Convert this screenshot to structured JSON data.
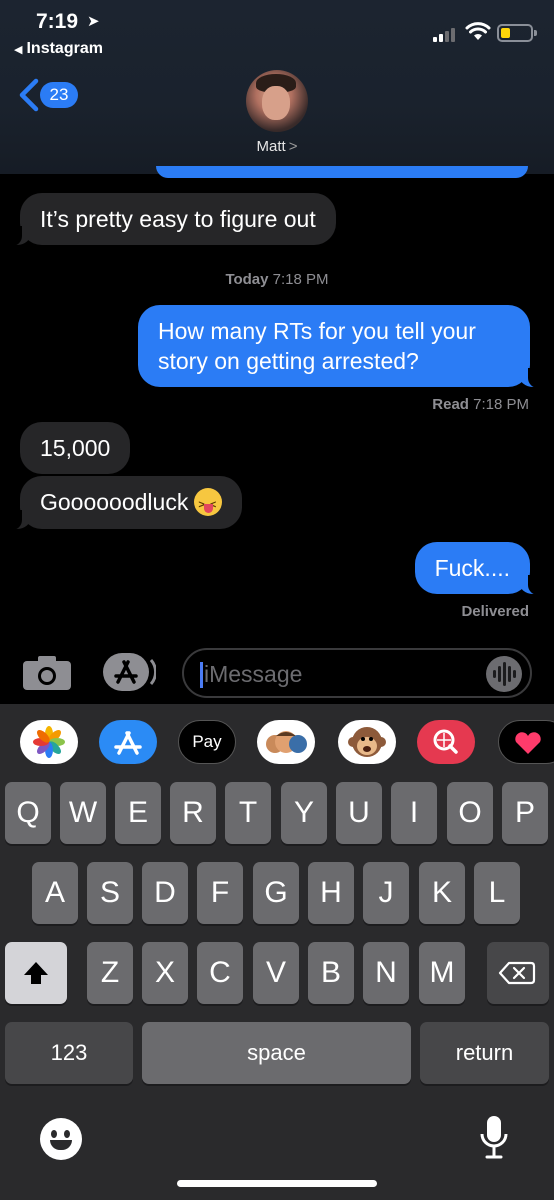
{
  "status_bar": {
    "time": "7:19",
    "back_app": "Instagram"
  },
  "header": {
    "back_count": "23",
    "contact_name": "Matt",
    "contact_chevron": ">"
  },
  "messages": [
    {
      "type": "received",
      "text": "It’s pretty easy to figure out"
    },
    {
      "type": "timestamp",
      "day": "Today",
      "time": "7:18 PM"
    },
    {
      "type": "sent",
      "text": "How many RTs for you tell your story on getting arrested?"
    },
    {
      "type": "receipt",
      "label": "Read",
      "time": "7:18 PM"
    },
    {
      "type": "received",
      "text": "15,000"
    },
    {
      "type": "received",
      "text": "Goooooodluck"
    },
    {
      "type": "sent",
      "text": "Fuck...."
    },
    {
      "type": "receipt",
      "label": "Delivered"
    }
  ],
  "input": {
    "placeholder": "iMessage"
  },
  "app_drawer": [
    "photos",
    "app-store",
    "apple-pay",
    "memoji",
    "animoji",
    "search",
    "digital-touch"
  ],
  "apple_pay_label": "Pay",
  "keyboard": {
    "row1": [
      "Q",
      "W",
      "E",
      "R",
      "T",
      "Y",
      "U",
      "I",
      "O",
      "P"
    ],
    "row2": [
      "A",
      "S",
      "D",
      "F",
      "G",
      "H",
      "J",
      "K",
      "L"
    ],
    "row3": [
      "Z",
      "X",
      "C",
      "V",
      "B",
      "N",
      "M"
    ],
    "numbers": "123",
    "space": "space",
    "return": "return"
  },
  "colors": {
    "sent_bubble": "#2b7cf5",
    "received_bubble": "#262628",
    "keyboard_bg": "#2a2a2c"
  }
}
